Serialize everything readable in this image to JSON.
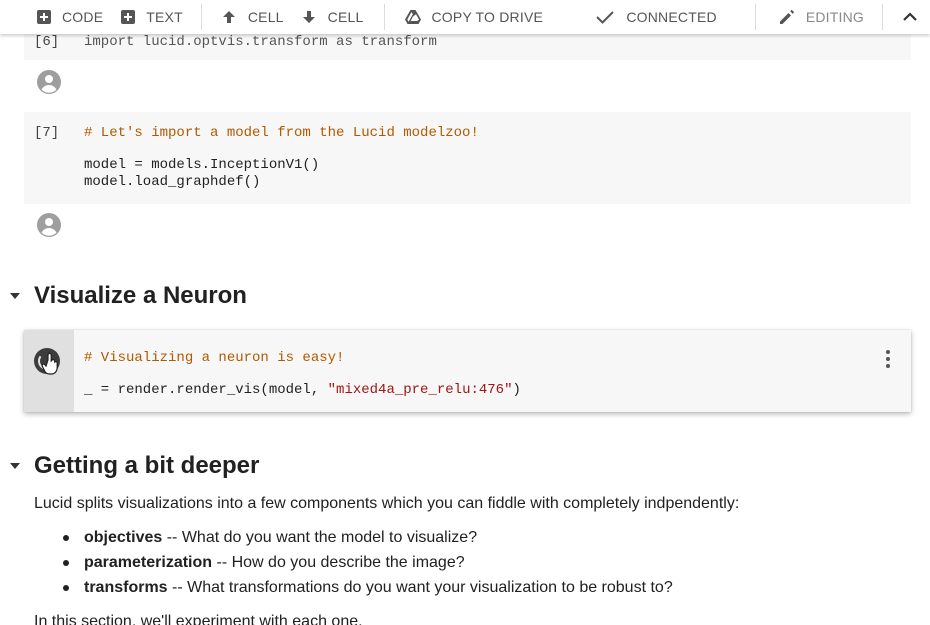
{
  "toolbar": {
    "code_label": "CODE",
    "text_label": "TEXT",
    "cell_up_label": "CELL",
    "cell_down_label": "CELL",
    "copy_to_drive_label": "COPY TO DRIVE",
    "connected_label": "CONNECTED",
    "editing_label": "EDITING"
  },
  "cells": {
    "cell6": {
      "exec_count": "[6]",
      "code": "import lucid.optvis.transform as transform"
    },
    "cell7": {
      "exec_count": "[7]",
      "comment": "# Let's import a model from the Lucid modelzoo!",
      "line2": "model = models.InceptionV1()",
      "line3": "model.load_graphdef()"
    },
    "neuron_cell": {
      "comment": "# Visualizing a neuron is easy!",
      "code_prefix": "_ = render.render_vis(model, ",
      "code_string": "\"mixed4a_pre_relu:476\"",
      "code_suffix": ")"
    }
  },
  "sections": {
    "visualize_neuron": "Visualize a Neuron",
    "getting_deeper": "Getting a bit deeper"
  },
  "text": {
    "intro": "Lucid splits visualizations into a few components which you can fiddle with completely indpendently:",
    "bullets": [
      {
        "term": "objectives",
        "desc": " -- What do you want the model to visualize?"
      },
      {
        "term": "parameterization",
        "desc": " -- How do you describe the image?"
      },
      {
        "term": "transforms",
        "desc": " -- What transformations do you want your visualization to be robust to?"
      }
    ],
    "outro": "In this section, we'll experiment with each one."
  },
  "colors": {
    "comment": "#b05a00",
    "string": "#a31515",
    "toolbar_text": "#555555",
    "cell_background": "#f7f7f7"
  },
  "icons": {
    "code": "plus-box-icon",
    "text": "plus-box-icon",
    "cell_up": "arrow-up-icon",
    "cell_down": "arrow-down-icon",
    "drive": "drive-icon",
    "connected": "checkmark-icon",
    "editing": "pencil-icon",
    "collapse": "chevron-up-icon",
    "avatar": "account-circle-icon",
    "run": "run-cell-icon",
    "more": "more-vert-icon"
  }
}
